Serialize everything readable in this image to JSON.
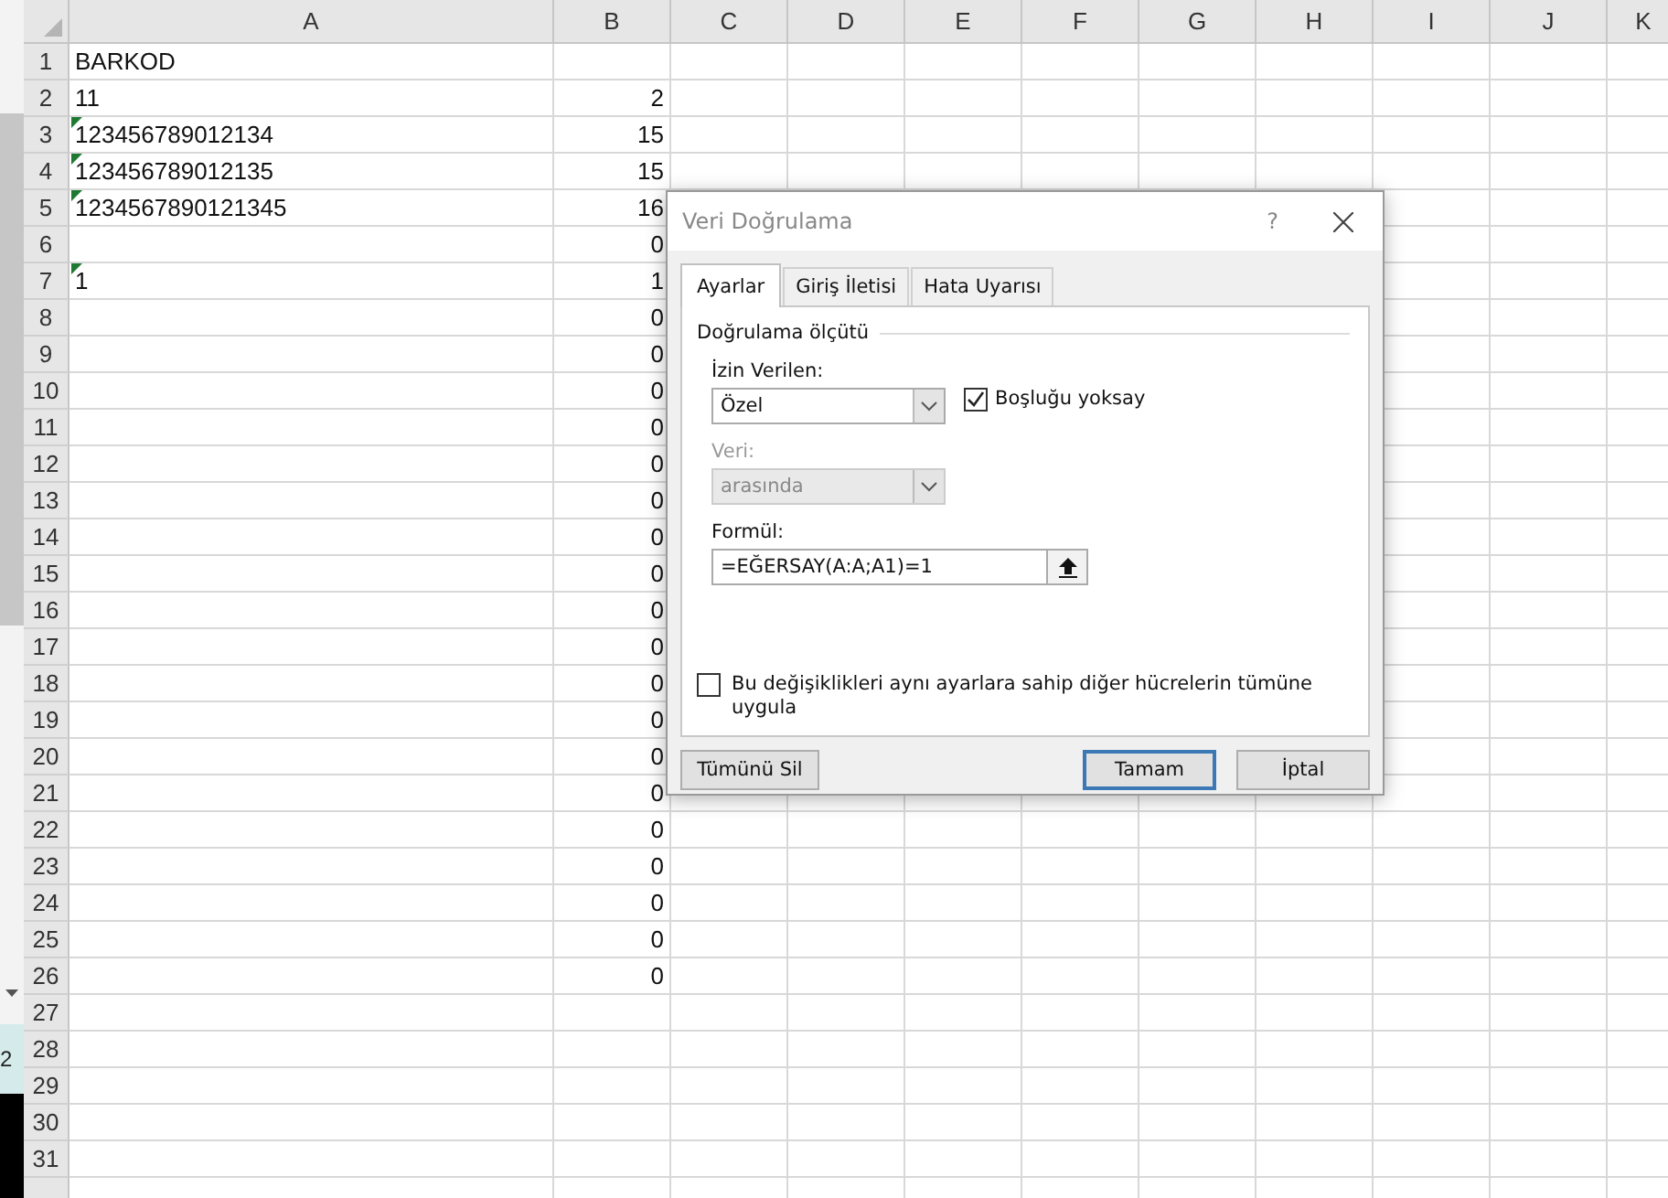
{
  "left_strip": {
    "text": "2"
  },
  "columns": [
    "A",
    "B",
    "C",
    "D",
    "E",
    "F",
    "G",
    "H",
    "I",
    "J",
    "K"
  ],
  "rows": [
    {
      "number": "1",
      "a": "BARKOD",
      "marker": false
    },
    {
      "number": "2",
      "a": "11",
      "b": "2",
      "marker": false
    },
    {
      "number": "3",
      "a": "123456789012134",
      "b": "15",
      "marker": true
    },
    {
      "number": "4",
      "a": "123456789012135",
      "b": "15",
      "marker": true
    },
    {
      "number": "5",
      "a": "1234567890121345",
      "b": "16",
      "marker": true
    },
    {
      "number": "6",
      "b": "0",
      "marker": false
    },
    {
      "number": "7",
      "a": "1",
      "b": "1",
      "marker": true
    },
    {
      "number": "8",
      "b": "0",
      "marker": false
    },
    {
      "number": "9",
      "b": "0",
      "marker": false
    },
    {
      "number": "10",
      "b": "0",
      "marker": false
    },
    {
      "number": "11",
      "b": "0",
      "marker": false
    },
    {
      "number": "12",
      "b": "0",
      "marker": false
    },
    {
      "number": "13",
      "b": "0",
      "marker": false
    },
    {
      "number": "14",
      "b": "0",
      "marker": false
    },
    {
      "number": "15",
      "b": "0",
      "marker": false
    },
    {
      "number": "16",
      "b": "0",
      "marker": false
    },
    {
      "number": "17",
      "b": "0",
      "marker": false
    },
    {
      "number": "18",
      "b": "0",
      "marker": false
    },
    {
      "number": "19",
      "b": "0",
      "marker": false
    },
    {
      "number": "20",
      "b": "0",
      "marker": false
    },
    {
      "number": "21",
      "b": "0",
      "marker": false
    },
    {
      "number": "22",
      "b": "0",
      "marker": false
    },
    {
      "number": "23",
      "b": "0",
      "marker": false
    },
    {
      "number": "24",
      "b": "0",
      "marker": false
    },
    {
      "number": "25",
      "b": "0",
      "marker": false
    },
    {
      "number": "26",
      "b": "0",
      "marker": false
    },
    {
      "number": "27",
      "marker": false
    },
    {
      "number": "28",
      "marker": false
    },
    {
      "number": "29",
      "marker": false
    },
    {
      "number": "30",
      "marker": false
    },
    {
      "number": "31",
      "marker": false
    }
  ],
  "dialog": {
    "title": "Veri Doğrulama",
    "help": "?",
    "tabs": [
      {
        "label": "Ayarlar",
        "selected": true
      },
      {
        "label": "Giriş İletisi",
        "selected": false
      },
      {
        "label": "Hata Uyarısı",
        "selected": false
      }
    ],
    "group_title": "Doğrulama ölçütü",
    "allow": {
      "label": "İzin Verilen:",
      "value": "Özel",
      "disabled": false
    },
    "ignore_blank": {
      "label": "Boşluğu yoksay",
      "checked": true
    },
    "data": {
      "label": "Veri:",
      "value": "arasında",
      "disabled": true
    },
    "formula": {
      "label": "Formül:",
      "value": "=EĞERSAY(A:A;A1)=1"
    },
    "apply_all": {
      "label": "Bu değişiklikleri aynı ayarlara sahip diğer hücrelerin tümüne uygula",
      "checked": false
    },
    "buttons": [
      {
        "label": "Tümünü Sil",
        "default": false
      },
      {
        "label": "Tamam",
        "default": true
      },
      {
        "label": "İptal",
        "default": false
      }
    ]
  }
}
